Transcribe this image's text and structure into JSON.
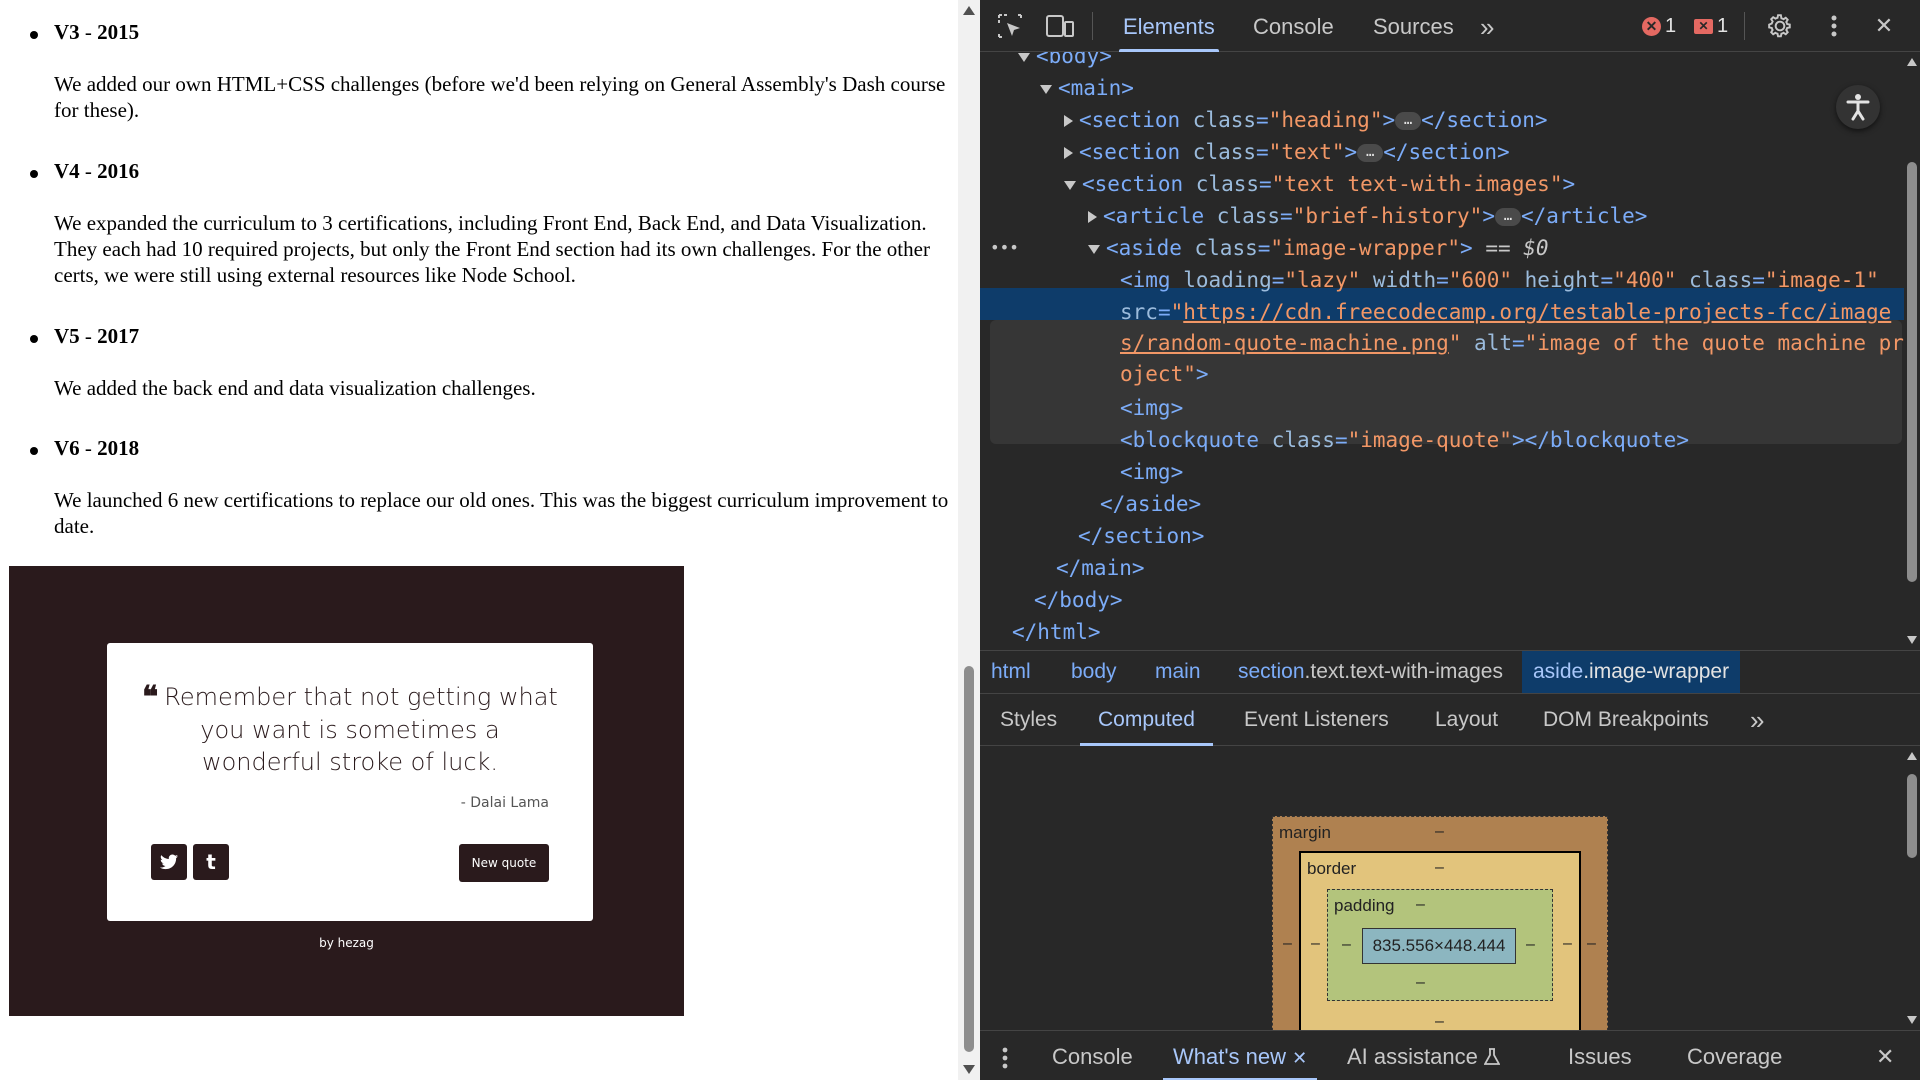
{
  "page": {
    "history": [
      {
        "version": "V3",
        "year": "2015",
        "text": "We added our own HTML+CSS challenges (before we'd been relying on General Assembly's Dash course for these)."
      },
      {
        "version": "V4",
        "year": "2016",
        "text": "We expanded the curriculum to 3 certifications, including Front End, Back End, and Data Visualization. They each had 10 required projects, but only the Front End section had its own challenges. For the other certs, we were still using external resources like Node School."
      },
      {
        "version": "V5",
        "year": "2017",
        "text": "We added the back end and data visualization challenges."
      },
      {
        "version": "V6",
        "year": "2018",
        "text": "We launched 6 new certifications to replace our old ones. This was the biggest curriculum improvement to date."
      }
    ],
    "separator": " - ",
    "quote_image": {
      "quote_mark": "❝",
      "quote": "Remember that not getting what you want is sometimes a wonderful stroke of luck.",
      "author": "- Dalai Lama",
      "twitter": "t",
      "tumblr": "t",
      "button": "New quote",
      "byline": "by hezag",
      "bg_color": "#2a1a1c"
    }
  },
  "devtools": {
    "tabs": [
      "Elements",
      "Console",
      "Sources"
    ],
    "more": "»",
    "errors": "1",
    "issues": "1",
    "dom": {
      "body_open": "<body>",
      "main_open": "<main>",
      "l_section": "<section ",
      "class_attr": "class",
      "eq": "=",
      "heading_val": "\"heading\"",
      "text_val": "\"text\"",
      "twi_val": "\"text text-with-images\"",
      "close_gt": ">",
      "section_close": "</section>",
      "ellipsis": "…",
      "article_open": "<article ",
      "brief_val": "\"brief-history\"",
      "article_close": "</article>",
      "aside_open": "<aside ",
      "iw_val": "\"image-wrapper\"",
      "eq_dollar": " == ",
      "dollar": "$0",
      "img_open": "<img ",
      "loading": "loading",
      "lazy": "\"lazy\"",
      "width": "width",
      "w600": "\"600\"",
      "height": "height",
      "h400": "\"400\"",
      "img1": "\"image-1\"",
      "src": "src",
      "src_q": "\"",
      "url1": "https://cdn.freecodecamp.org/testable-projects-fcc/image",
      "url2": "s/random-quote-machine.png",
      "alt": "alt",
      "alt1": "\"image of the quote machine pr",
      "alt2": "oject\"",
      "img_plain": "<img>",
      "bq_open": "<blockquote ",
      "bq_val": "\"image-quote\"",
      "bq_close": "></blockquote>",
      "aside_close": "</aside>",
      "main_close": "</main>",
      "body_close": "</body>",
      "html_close": "</html>",
      "dots": "•••"
    },
    "breadcrumbs": [
      {
        "tag": "html",
        "cls": ""
      },
      {
        "tag": "body",
        "cls": ""
      },
      {
        "tag": "main",
        "cls": ""
      },
      {
        "tag": "section",
        "cls": ".text.text-with-images"
      },
      {
        "tag": "aside",
        "cls": ".image-wrapper"
      }
    ],
    "subtabs": [
      "Styles",
      "Computed",
      "Event Listeners",
      "Layout",
      "DOM Breakpoints"
    ],
    "box_model": {
      "margin": "margin",
      "border": "border",
      "padding": "padding",
      "content": "835.556×448.444",
      "dash": "–"
    },
    "drawer_tabs": [
      "Console",
      "What's new",
      "AI assistance",
      "Issues",
      "Coverage"
    ],
    "close": "✕"
  }
}
